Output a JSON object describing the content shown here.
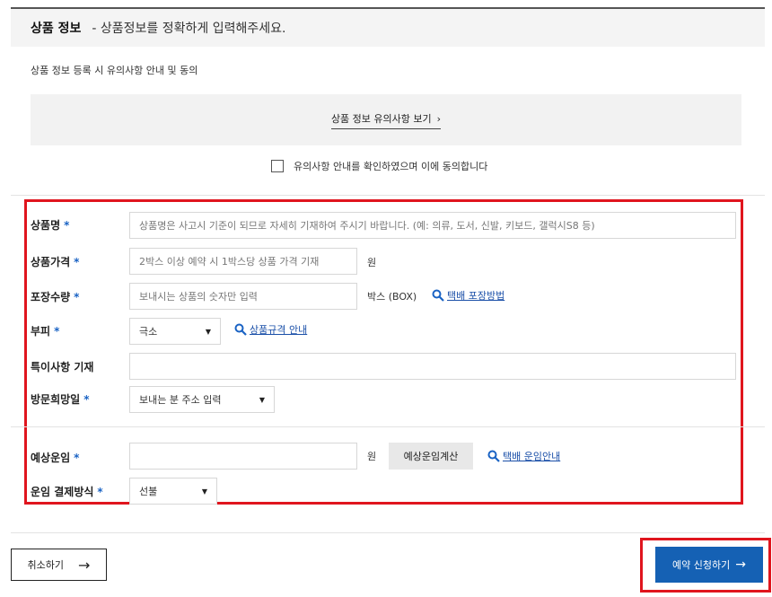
{
  "header": {
    "title": "상품 정보",
    "subtitle": "- 상품정보를 정확하게 입력해주세요."
  },
  "notice": {
    "label": "상품 정보 등록 시 유의사항 안내 및 동의",
    "link_text": "상품 정보 유의사항 보기",
    "link_chevron": "›",
    "agree_text": "유의사항 안내를 확인하였으며 이에 동의합니다",
    "agree_checked": false
  },
  "form": {
    "required_mark": "*",
    "product_name": {
      "label": "상품명",
      "placeholder": "상품명은 사고시 기준이 되므로 자세히 기재하여 주시기 바랍니다. (예: 의류, 도서, 신발, 키보드, 갤럭시S8 등)"
    },
    "product_price": {
      "label": "상품가격",
      "placeholder": "2박스 이상 예약 시 1박스당 상품 가격 기재",
      "unit": "원"
    },
    "package_qty": {
      "label": "포장수량",
      "placeholder": "보내시는 상품의 숫자만 입력",
      "unit": "박스 (BOX)",
      "guide_link": "택배 포장방법"
    },
    "volume": {
      "label": "부피",
      "selected": "극소",
      "guide_link": "상품규격 안내"
    },
    "special_notes": {
      "label": "특이사항 기재",
      "value": ""
    },
    "visit_date": {
      "label": "방문희망일",
      "selected": "보내는 분 주소 입력"
    },
    "estimated_fare": {
      "label": "예상운임",
      "value": "",
      "unit": "원",
      "calc_button": "예상운임계산",
      "guide_link": "택배 운임안내"
    },
    "payment_method": {
      "label": "운임 결제방식",
      "selected": "선불"
    }
  },
  "footer": {
    "cancel_label": "취소하기",
    "cancel_arrow": "→",
    "submit_label": "예약 신청하기",
    "submit_arrow": "→"
  },
  "colors": {
    "accent_blue": "#1561b4",
    "link_blue": "#1a4fa8",
    "highlight_red": "#e0151e"
  },
  "icons": {
    "magnifier": "magnifier-icon",
    "select_caret": "caret-down-icon",
    "arrow": "arrow-right-icon"
  }
}
